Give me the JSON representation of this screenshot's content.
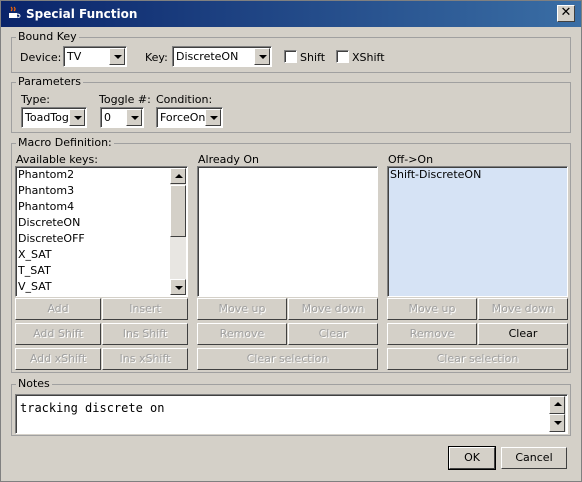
{
  "window": {
    "title": "Special Function",
    "close_label": "✕"
  },
  "bound_key": {
    "legend": "Bound Key",
    "device_label": "Device:",
    "device_value": "TV",
    "key_label": "Key:",
    "key_value": "DiscreteON",
    "shift_label": "Shift",
    "shift_checked": false,
    "xshift_label": "XShift",
    "xshift_checked": false
  },
  "parameters": {
    "legend": "Parameters",
    "type_label": "Type:",
    "type_value": "ToadTog",
    "toggle_label": "Toggle #:",
    "toggle_value": "0",
    "condition_label": "Condition:",
    "condition_value": "ForceOn"
  },
  "macro": {
    "legend": "Macro Definition:",
    "available_label": "Available keys:",
    "available_keys": [
      "Phantom2",
      "Phantom3",
      "Phantom4",
      "DiscreteON",
      "DiscreteOFF",
      "X_SAT",
      "T_SAT",
      "V_SAT"
    ],
    "already_on_label": "Already On",
    "already_on_items": [],
    "off_on_label": "Off->On",
    "off_on_items": [
      "Shift-DiscreteON"
    ],
    "buttons": {
      "add": "Add",
      "insert": "Insert",
      "add_shift": "Add Shift",
      "ins_shift": "Ins Shift",
      "add_xshift": "Add xShift",
      "ins_xshift": "Ins xShift",
      "move_up": "Move up",
      "move_down": "Move down",
      "remove": "Remove",
      "clear": "Clear",
      "clear_selection": "Clear selection"
    }
  },
  "notes": {
    "legend": "Notes",
    "text": "tracking discrete on"
  },
  "footer": {
    "ok_label": "OK",
    "cancel_label": "Cancel"
  }
}
